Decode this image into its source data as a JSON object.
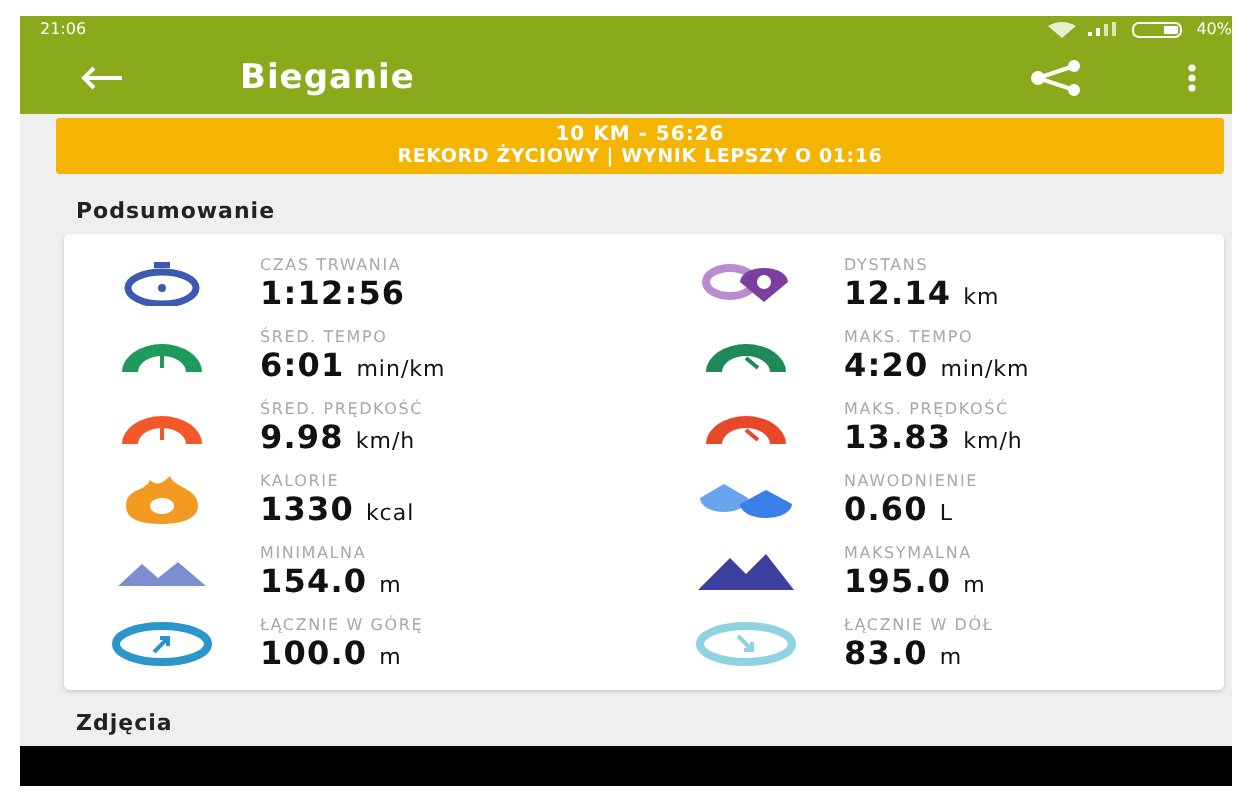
{
  "status_bar": {
    "time": "21:06",
    "battery": "40%"
  },
  "app_bar": {
    "title": "Bieganie"
  },
  "banner": {
    "line_1": "10 KM  -  56:26",
    "line_2": "REKORD ŻYCIOWY  |  WYNIK LEPSZY O 01:16"
  },
  "summary": {
    "title": "Podsumowanie",
    "stats": [
      {
        "kind": "stopwatch",
        "label": "CZAS TRWANIA",
        "value": "1:12:56"
      },
      {
        "kind": "distance",
        "label": "DYSTANS",
        "value": "12.14",
        "unit": "km"
      },
      {
        "kind": "gauge-avg-pace",
        "label": "ŚRED. TEMPO",
        "value": "6:01",
        "unit": "min/km"
      },
      {
        "kind": "gauge-max-pace",
        "label": "MAKS. TEMPO",
        "value": "4:20",
        "unit": "min/km"
      },
      {
        "kind": "gauge-avg-speed",
        "label": "ŚRED. PRĘDKOŚĆ",
        "value": "9.98",
        "unit": "km/h"
      },
      {
        "kind": "gauge-max-speed",
        "label": "MAKS. PRĘDKOŚĆ",
        "value": "13.83",
        "unit": "km/h"
      },
      {
        "kind": "flame",
        "label": "KALORIE",
        "value": "1330",
        "unit": "kcal"
      },
      {
        "kind": "drops",
        "label": "NAWODNIENIE",
        "value": "0.60",
        "unit": "L"
      },
      {
        "kind": "mountain-min",
        "label": "MINIMALNA",
        "value": "154.0",
        "unit": "m"
      },
      {
        "kind": "mountain-max",
        "label": "MAKSYMALNA",
        "value": "195.0",
        "unit": "m"
      },
      {
        "kind": "ascent",
        "label": "ŁĄCZNIE W GÓRĘ",
        "value": "100.0",
        "unit": "m"
      },
      {
        "kind": "descent",
        "label": "ŁĄCZNIE W DÓŁ",
        "value": "83.0",
        "unit": "m"
      }
    ]
  },
  "photos": {
    "title": "Zdjęcia"
  }
}
